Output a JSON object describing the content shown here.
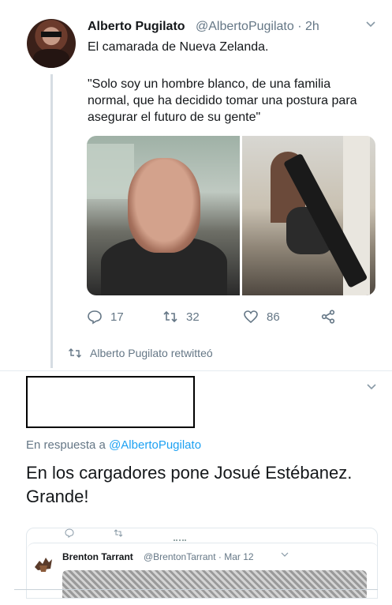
{
  "tweet1": {
    "name": "Alberto Pugilato",
    "handle": "@AlbertoPugilato · 2h",
    "text": "El camarada de Nueva Zelanda.",
    "quote": "\"Solo soy un hombre blanco, de una familia normal, que ha decidido tomar una postura para asegurar el futuro de su gente\"",
    "actions": {
      "reply_count": "17",
      "retweet_count": "32",
      "like_count": "86"
    },
    "menu_icon": "chevron-down-icon"
  },
  "retweet_notice": "Alberto Pugilato retwitteó",
  "tweet2": {
    "reply_prefix": "En respuesta a ",
    "reply_handle": "@AlbertoPugilato",
    "text": "En los cargadores pone Josué Estébanez. Grande!",
    "menu_icon": "chevron-down-icon"
  },
  "embedded_tweet": {
    "name": "Brenton Tarrant",
    "handle": "@BrentonTarrant · Mar 12",
    "menu_icon": "chevron-down-icon"
  },
  "colors": {
    "accent": "#1da1f2",
    "muted": "#657786",
    "text": "#14171a"
  }
}
